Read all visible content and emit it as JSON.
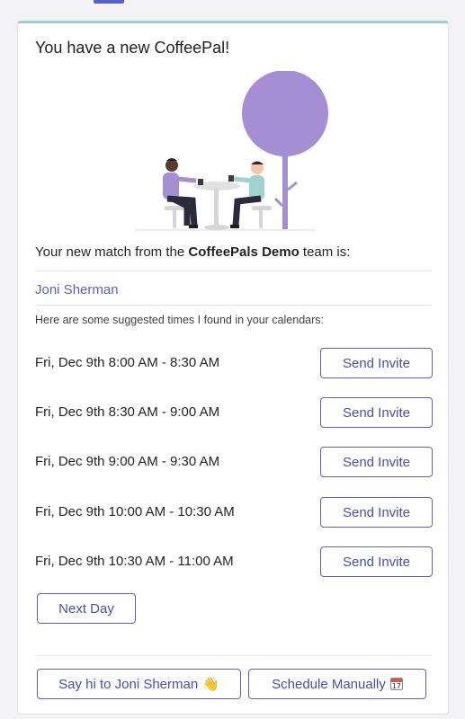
{
  "card": {
    "title": "You have a new CoffeePal!",
    "match_prefix": "Your new match from the ",
    "team_name": "CoffeePals Demo",
    "match_suffix": " team is:",
    "match_name": "Joni Sherman",
    "suggest_text": "Here are some suggested times I found in your calendars:"
  },
  "slots": [
    {
      "time": "Fri, Dec 9th 8:00 AM - 8:30 AM",
      "button": "Send Invite"
    },
    {
      "time": "Fri, Dec 9th 8:30 AM - 9:00 AM",
      "button": "Send Invite"
    },
    {
      "time": "Fri, Dec 9th 9:00 AM - 9:30 AM",
      "button": "Send Invite"
    },
    {
      "time": "Fri, Dec 9th 10:00 AM - 10:30 AM",
      "button": "Send Invite"
    },
    {
      "time": "Fri, Dec 9th 10:30 AM - 11:00 AM",
      "button": "Send Invite"
    }
  ],
  "actions": {
    "next_day": "Next Day",
    "say_hi": "Say hi to Joni Sherman",
    "say_hi_emoji": "👋",
    "schedule_manually": "Schedule Manually",
    "calendar_icon_text": "17"
  },
  "colors": {
    "accent": "#5b5fc7",
    "card_top_border": "#9ecfd0",
    "illustration_purple": "#a58fd4"
  },
  "icons": {
    "say_hi": "waving-hand-icon",
    "schedule": "calendar-icon"
  }
}
